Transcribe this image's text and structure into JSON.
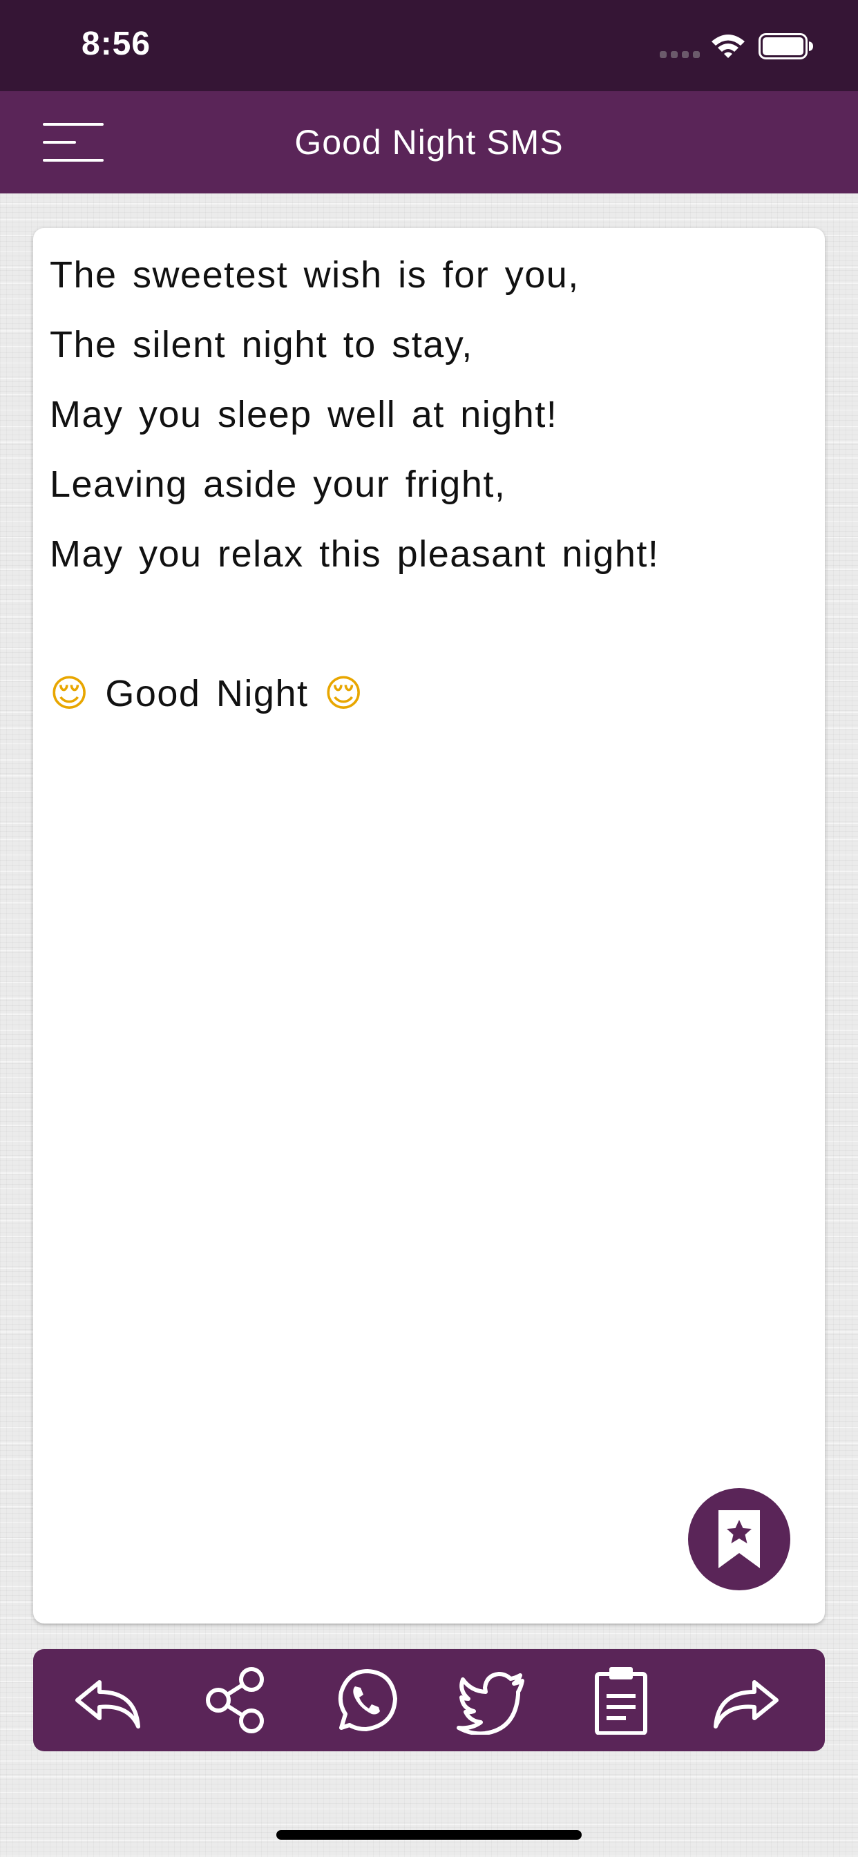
{
  "status_bar": {
    "time": "8:56",
    "icons": [
      "signal-icon",
      "wifi-icon",
      "battery-icon"
    ]
  },
  "header": {
    "title": "Good Night SMS",
    "menu_icon": "hamburger-menu-icon"
  },
  "message": {
    "lines": [
      "The sweetest wish is for you,",
      "The silent night to stay,",
      "May you sleep well at night!",
      "Leaving aside your fright,",
      "May you relax this pleasant night!",
      "",
      "Good Night"
    ],
    "emoji": "😌"
  },
  "favorite_icon": "bookmark-star-icon",
  "toolbar": {
    "icons": [
      "back-arrow-icon",
      "share-icon",
      "whatsapp-icon",
      "twitter-icon",
      "clipboard-icon",
      "forward-arrow-icon"
    ]
  },
  "colors": {
    "status_bar": "#351535",
    "accent": "#5a2558",
    "card": "#ffffff",
    "background": "#ebebeb"
  }
}
